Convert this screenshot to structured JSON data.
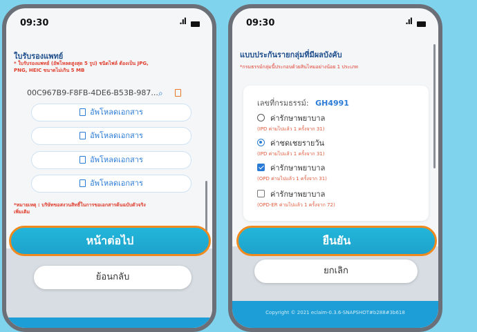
{
  "left": {
    "time": "09:30",
    "signal": ".ıl",
    "section_title": "ใบรับรองแพทย์",
    "note_line1": "* ใบรับรองแพทย์ (อัพโหลดสูงสุด 5 รูป) ชนิดไฟล์ ต้องเป็น JPG,",
    "note_line2": "PNG, HEIC ขนาดไม่เกิน 5 MB",
    "file_name": "00C967B9-F8FB-4DE6-B53B-987...",
    "upload_buttons": [
      "อัพโหลดเอกสาร",
      "อัพโหลดเอกสาร",
      "อัพโหลดเอกสาร",
      "อัพโหลดเอกสาร"
    ],
    "remark_line1": "*หมายเหตุ : บริษัทขอสงวนสิทธิ์ในการขอเอกสารต้นฉบับตัวจริง",
    "remark_line2": "เพิ่มเติม",
    "next_label": "หน้าต่อไป",
    "back_label": "ย้อนกลับ"
  },
  "right": {
    "time": "09:30",
    "signal": ".ıl",
    "section_title": "แบบประกันรายกลุ่มที่มีผลบังคับ",
    "note": "*กรมธรรม์กลุ่มนี้ประกอบด้วยสินไหมอย่างน้อย 1 ประเภท",
    "policy_label": "เลขที่กรมธรรม์:",
    "policy_no": "GH4991",
    "options": [
      {
        "label": "ค่ารักษาพยาบาล",
        "sub": "(IPD ค่ามไปแล้ว 1 ครั้งจาก 31)"
      },
      {
        "label": "ค่าชดเชยรายวัน",
        "sub": "(IPD ค่ามไปแล้ว 1 ครั้งจาก 31)"
      },
      {
        "label": "ค่ารักษาพยาบาล",
        "sub": "(OPD ค่ามไปแล้ว 1 ครั้งจาก 31)"
      },
      {
        "label": "ค่ารักษาพยาบาล",
        "sub": "(OPD-ER ค่ามไปแล้ว 1 ครั้งจาก 72)"
      }
    ],
    "confirm_label": "ยืนยัน",
    "cancel_label": "ยกเลิก",
    "copyright": "Copyright © 2021 eclaim-0.3.6-SNAPSHOT#b288#3b618"
  }
}
